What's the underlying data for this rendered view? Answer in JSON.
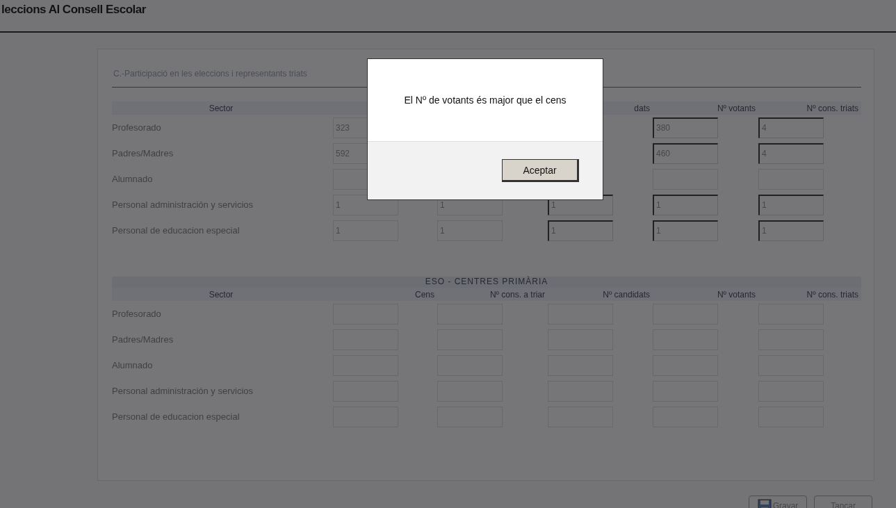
{
  "window": {
    "title": "leccions Al Consell Escolar"
  },
  "section_title": "C.-Participació en les eleccions i representants triats",
  "tables": [
    {
      "columns": [
        "Sector",
        null,
        null,
        "dats",
        "Nº votants",
        "Nº cons. triats"
      ],
      "rows": [
        {
          "label": "Profesorado",
          "cells": [
            {
              "value": "323",
              "disabled": true
            },
            null,
            null,
            {
              "value": "380",
              "disabled": false
            },
            {
              "value": "4",
              "disabled": false
            }
          ]
        },
        {
          "label": "Padres/Madres",
          "cells": [
            {
              "value": "592",
              "disabled": true
            },
            null,
            null,
            {
              "value": "460",
              "disabled": false
            },
            {
              "value": "4",
              "disabled": false
            }
          ]
        },
        {
          "label": "Alumnado",
          "cells": [
            {
              "disabled": true
            },
            null,
            null,
            {
              "disabled": true
            },
            {
              "disabled": true
            }
          ]
        },
        {
          "label": "Personal administración y servicios",
          "cells": [
            {
              "value": "1",
              "disabled": true
            },
            {
              "value": "1",
              "disabled": true
            },
            {
              "value": "1",
              "disabled": false
            },
            {
              "value": "1",
              "disabled": false
            },
            {
              "value": "1",
              "disabled": false
            }
          ]
        },
        {
          "label": "Personal de educacion especial",
          "cells": [
            {
              "value": "1",
              "disabled": true
            },
            {
              "value": "1",
              "disabled": true
            },
            {
              "value": "1",
              "disabled": false
            },
            {
              "value": "1",
              "disabled": false
            },
            {
              "value": "1",
              "disabled": false
            }
          ]
        }
      ]
    },
    {
      "caption": "ESO - CENTRES PRIMÀRIA",
      "columns": [
        "Sector",
        "Cens",
        "Nº cons. a triar",
        "Nº candidats",
        "Nº votants",
        "Nº cons. triats"
      ],
      "rows": [
        {
          "label": "Profesorado",
          "cells": [
            {
              "disabled": true
            },
            {
              "disabled": true
            },
            {
              "disabled": true
            },
            {
              "disabled": true
            },
            {
              "disabled": true
            }
          ]
        },
        {
          "label": "Padres/Madres",
          "cells": [
            {
              "disabled": true
            },
            {
              "disabled": true
            },
            {
              "disabled": true
            },
            {
              "disabled": true
            },
            {
              "disabled": true
            }
          ]
        },
        {
          "label": "Alumnado",
          "cells": [
            {
              "disabled": true
            },
            {
              "disabled": true
            },
            {
              "disabled": true
            },
            {
              "disabled": true
            },
            {
              "disabled": true
            }
          ]
        },
        {
          "label": "Personal administración y servicios",
          "cells": [
            {
              "disabled": true
            },
            {
              "disabled": true
            },
            {
              "disabled": true
            },
            {
              "disabled": true
            },
            {
              "disabled": true
            }
          ]
        },
        {
          "label": "Personal de educacion especial",
          "cells": [
            {
              "disabled": true
            },
            {
              "disabled": true
            },
            {
              "disabled": true
            },
            {
              "disabled": true
            },
            {
              "disabled": true
            }
          ]
        }
      ]
    }
  ],
  "buttons": [
    {
      "label": "Gravar",
      "has_icon": true
    },
    {
      "label": "Tancar",
      "has_icon": false
    }
  ],
  "dialog": {
    "message": "El Nº de votants és major que el cens",
    "button": "Aceptar"
  }
}
